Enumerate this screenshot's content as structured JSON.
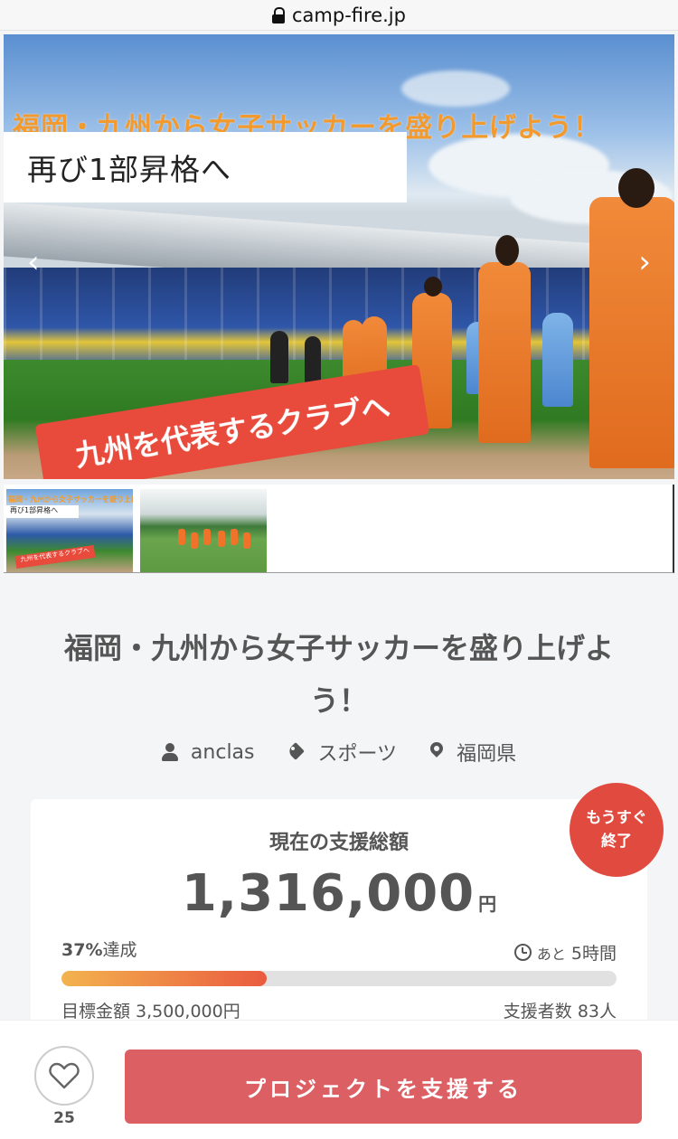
{
  "browser": {
    "url": "camp-fire.jp"
  },
  "hero": {
    "headline": "福岡・九州から女子サッカーを盛り上げよう！",
    "subtitle": "再び1部昇格へ",
    "banner": "九州を代表するクラブへ",
    "prev_arrow": "‹",
    "next_arrow": "›"
  },
  "thumbnails": [
    {
      "mini_title": "福岡・九州から女子サッカーを盛り上げよう！",
      "mini_subtitle": "再び1部昇格へ",
      "mini_banner": "九州を代表するクラブへ"
    },
    {}
  ],
  "project": {
    "title": "福岡・九州から女子サッカーを盛り上げよう！",
    "owner": "anclas",
    "category": "スポーツ",
    "location": "福岡県"
  },
  "funding": {
    "label": "現在の支援総額",
    "amount": "1,316,000",
    "unit": "円",
    "badge_line1": "もうすぐ",
    "badge_line2": "終了",
    "percent": "37%",
    "percent_suffix": "達成",
    "progress_fraction": 0.37,
    "remaining_prefix": "あと",
    "remaining_value": "5時間",
    "goal_text": "目標金額 3,500,000円",
    "backers_text": "支援者数 83人"
  },
  "actions": {
    "favorite_count": "25",
    "support_label": "プロジェクトを支援する"
  },
  "colors": {
    "accent": "#db5f63",
    "badge": "#e14b3f",
    "progress_start": "#f3b34e",
    "progress_end": "#ea5b3f"
  }
}
